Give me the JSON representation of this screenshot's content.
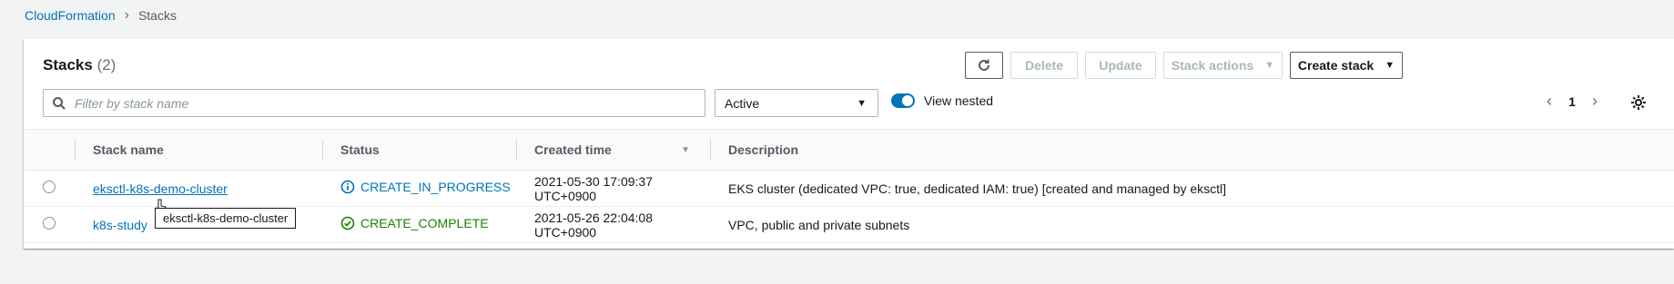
{
  "breadcrumb": {
    "parent": "CloudFormation",
    "separator_icon": "chevron-right-icon",
    "current": "Stacks"
  },
  "header": {
    "title": "Stacks",
    "count": "(2)"
  },
  "toolbar": {
    "refresh_icon": "refresh-icon",
    "delete_label": "Delete",
    "update_label": "Update",
    "stack_actions_label": "Stack actions",
    "create_stack_label": "Create stack"
  },
  "filter": {
    "search_placeholder": "Filter by stack name",
    "search_value": "",
    "status_selected": "Active",
    "view_nested_label": "View nested",
    "view_nested_on": true
  },
  "pagination": {
    "current_page": "1"
  },
  "table": {
    "columns": {
      "stack_name": "Stack name",
      "status": "Status",
      "created_time": "Created time",
      "description": "Description"
    },
    "rows": [
      {
        "stack_name": "eksctl-k8s-demo-cluster",
        "status": "CREATE_IN_PROGRESS",
        "status_icon": "info-icon",
        "created_time": "2021-05-30 17:09:37 UTC+0900",
        "description": "EKS cluster (dedicated VPC: true, dedicated IAM: true) [created and managed by eksctl]"
      },
      {
        "stack_name": "k8s-study",
        "status": "CREATE_COMPLETE",
        "status_icon": "check-circle-icon",
        "created_time": "2021-05-26 22:04:08 UTC+0900",
        "description": "VPC, public and private subnets"
      }
    ]
  },
  "tooltip": {
    "text": "eksctl-k8s-demo-cluster"
  },
  "colors": {
    "link": "#0073bb",
    "in_progress": "#0073bb",
    "complete": "#1d8102",
    "toggle_on": "#0073bb"
  }
}
